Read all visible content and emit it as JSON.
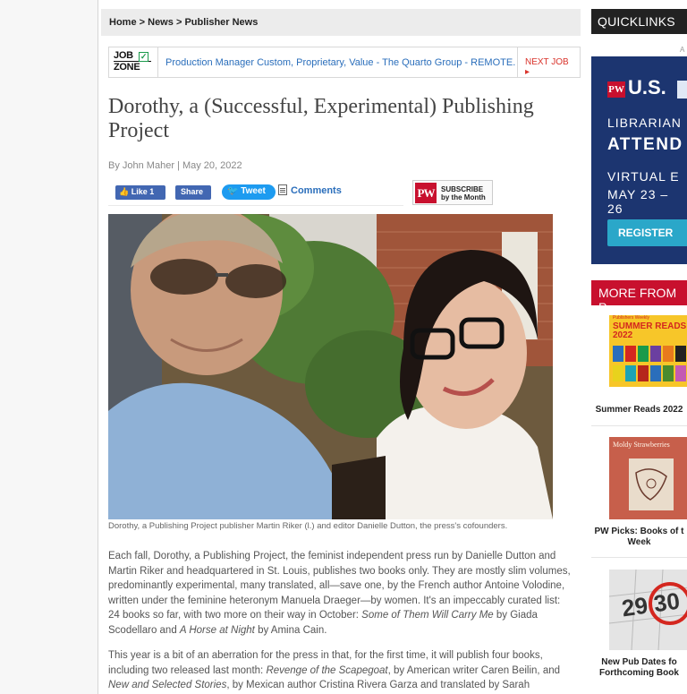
{
  "breadcrumb": {
    "items": [
      "Home",
      "News",
      "Publisher News"
    ],
    "separator": ">"
  },
  "jobzone": {
    "logo_line1": "JOB",
    "logo_line2": "ZONE",
    "title": "Production Manager Custom, Proprietary, Value - The Quarto Group - REMOTE.",
    "next_label": "NEXT JOB ▸"
  },
  "article": {
    "headline": "Dorothy, a (Successful, Experimental) Publishing Project",
    "byline": "By John Maher | May 20, 2022",
    "caption": "Dorothy, a Publishing Project publisher Martin Riker (l.) and editor Danielle Dutton, the press's cofounders.",
    "p1": {
      "t1": "Each fall, Dorothy, a Publishing Project, the feminist independent press run by Danielle Dutton and Martin Riker and headquartered in St. Louis, publishes two books only. They are mostly slim volumes, predominantly experimental, many translated, all—save one, by the French author Antoine Volodine, written under the feminine heteronym Manuela Draeger—by women. It's an impeccably curated list: 24 books so far, with two more on their way in October: ",
      "i1": "Some of Them Will Carry Me",
      "t2": " by Giada Scodellaro and ",
      "i2": "A Horse at Night",
      "t3": " by Amina Cain."
    },
    "p2": {
      "t1": "This year is a bit of an aberration for the press in that, for the first time, it will publish four books, including two released last month: ",
      "i1": "Revenge of the Scapegoat",
      "t2": ", by American writer Caren Beilin, and ",
      "i2": "New and Selected Stories",
      "t3": ", by Mexican author Cristina Rivera Garza and translated by Sarah"
    }
  },
  "share": {
    "like_label": "Like 1",
    "share_label": "Share",
    "tweet_label": "Tweet",
    "comments_label": "Comments"
  },
  "subscribe": {
    "logo": "PW",
    "line1": "SUBSCRIBE",
    "line2": "by the Month"
  },
  "sidebar": {
    "quicklinks_title": "QUICKLINKS",
    "ad_label": "A",
    "ad": {
      "logo": "PW",
      "brand": "U.S.",
      "line1": "LIBRARIAN",
      "line2": "ATTEND",
      "line3": "VIRTUAL E",
      "line4": "MAY 23 – 26",
      "button": "REGISTER"
    },
    "more_title": "MORE FROM P",
    "more_items": [
      {
        "title": "Summer Reads 2022",
        "thumb_text_small": "Publishers Weekly",
        "thumb_text": "SUMMER READS 2022"
      },
      {
        "title": "PW Picks: Books of t Week",
        "thumb_text": "Moldy Strawberries"
      },
      {
        "title": "New Pub Dates fo Forthcoming Book",
        "thumb_text": "29 30"
      }
    ]
  },
  "colors": {
    "link_blue": "#2a6ebb",
    "pw_red": "#c8102e",
    "facebook": "#4267b2",
    "twitter": "#1d9bf0",
    "ad_navy": "#1c3570"
  }
}
